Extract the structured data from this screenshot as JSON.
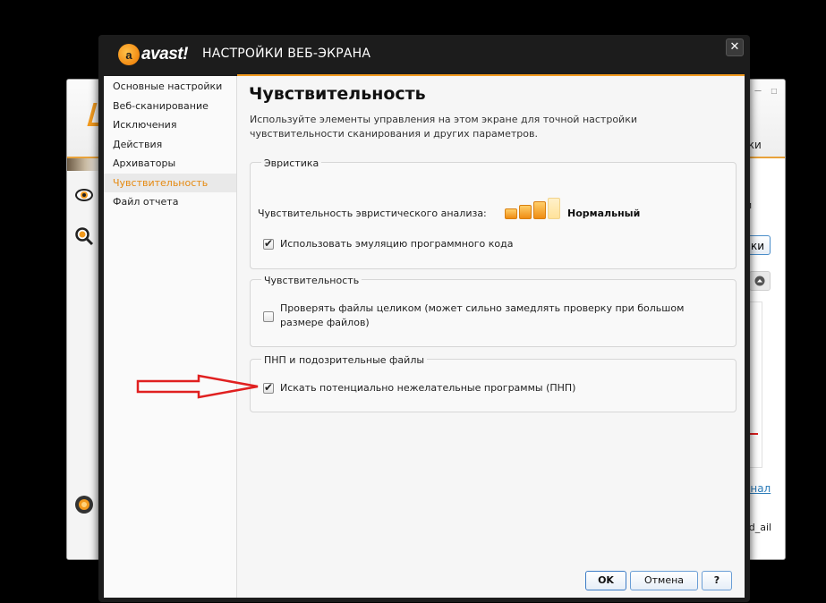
{
  "background_window": {
    "tab_fragment": "йки",
    "button_fragment": "ки",
    "side_fragment": "и",
    "link_fragment": "онал",
    "footer_fragment": "sd_ail",
    "window_buttons": [
      "—",
      "☐"
    ]
  },
  "dialog": {
    "logo_mark": "a",
    "logo_text": "avast!",
    "title": "НАСТРОЙКИ ВЕБ-ЭКРАНА",
    "close_symbol": "✕"
  },
  "nav": {
    "items": [
      "Основные настройки",
      "Веб-сканирование",
      "Исключения",
      "Действия",
      "Архиваторы",
      "Чувствительность",
      "Файл отчета"
    ],
    "active_index": 5
  },
  "page": {
    "title": "Чувствительность",
    "description": "Используйте элементы управления на этом экране для точной настройки чувствительности сканирования и других параметров."
  },
  "heuristics": {
    "group_label": "Эвристика",
    "sensitivity_label": "Чувствительность эвристического анализа:",
    "level_text": "Нормальный",
    "level_value": 3,
    "level_max": 4,
    "emulation_label": "Использовать эмуляцию программного кода",
    "emulation_checked": true
  },
  "sensitivity": {
    "group_label": "Чувствительность",
    "whole_files_label": "Проверять файлы целиком (может сильно замедлять проверку при большом размере файлов)",
    "whole_files_checked": false
  },
  "pup": {
    "group_label": "ПНП и подозрительные файлы",
    "search_label": "Искать потенциально нежелательные программы (ПНП)",
    "search_checked": true
  },
  "buttons": {
    "ok": "OK",
    "cancel": "Отмена",
    "help": "?"
  },
  "colors": {
    "accent": "#f29a1e",
    "arrow": "#e02020",
    "dialog_frame": "#1c1c1c",
    "button_border": "#6a9ed6"
  }
}
